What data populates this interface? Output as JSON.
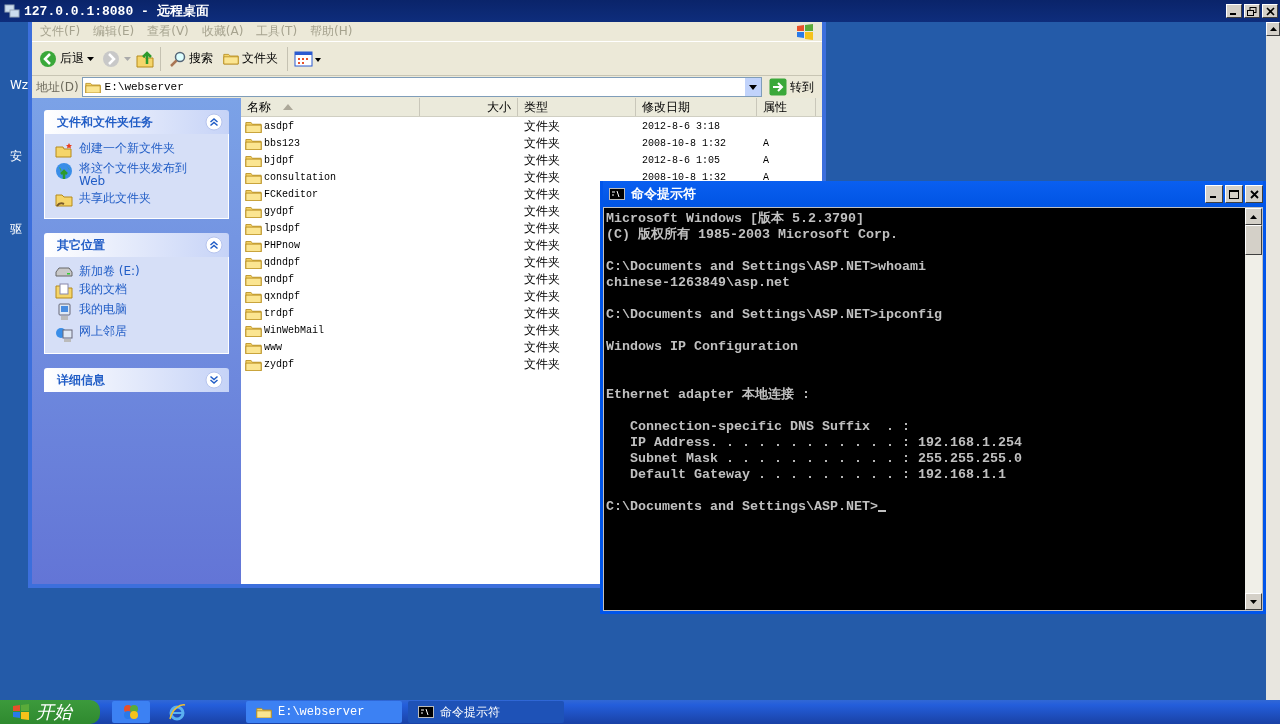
{
  "remote_window": {
    "title": "127.0.0.1:8080 - 远程桌面"
  },
  "desktop_labels": [
    "Wz",
    "安",
    "驱"
  ],
  "explorer": {
    "menu": [
      {
        "label": "文件(F)",
        "disabled": true
      },
      {
        "label": "编辑(E)",
        "disabled": true
      },
      {
        "label": "查看(V)",
        "disabled": true
      },
      {
        "label": "收藏(A)",
        "disabled": true
      },
      {
        "label": "工具(T)",
        "disabled": true
      },
      {
        "label": "帮助(H)",
        "disabled": true
      }
    ],
    "toolbar": {
      "back": "后退",
      "search": "搜索",
      "folders": "文件夹"
    },
    "address": {
      "label": "地址(D)",
      "value": "E:\\webserver",
      "go": "转到"
    },
    "panels": [
      {
        "title": "文件和文件夹任务",
        "expanded": true,
        "items": [
          {
            "label": "创建一个新文件夹",
            "kind": "new-folder"
          },
          {
            "label": "将这个文件夹发布到 Web",
            "kind": "publish"
          },
          {
            "label": "共享此文件夹",
            "kind": "share"
          }
        ]
      },
      {
        "title": "其它位置",
        "expanded": true,
        "items": [
          {
            "label": "新加卷 (E:)",
            "kind": "drive"
          },
          {
            "label": "我的文档",
            "kind": "documents"
          },
          {
            "label": "我的电脑",
            "kind": "computer"
          },
          {
            "label": "网上邻居",
            "kind": "network"
          }
        ]
      },
      {
        "title": "详细信息",
        "expanded": false
      }
    ],
    "columns": [
      {
        "label": "名称",
        "sorted": true
      },
      {
        "label": "大小",
        "sorted": false
      },
      {
        "label": "类型",
        "sorted": false
      },
      {
        "label": "修改日期",
        "sorted": false
      },
      {
        "label": "属性",
        "sorted": false
      }
    ],
    "rows": [
      {
        "name": "asdpf",
        "type": "文件夹",
        "modified": "2012-8-6 3:18"
      },
      {
        "name": "bbs123",
        "type": "文件夹",
        "modified": "2008-10-8 1:32",
        "attributes": "A"
      },
      {
        "name": "bjdpf",
        "type": "文件夹",
        "modified": "2012-8-6 1:05",
        "attributes": "A"
      },
      {
        "name": "consultation",
        "type": "文件夹",
        "modified": "2008-10-8 1:32",
        "attributes": "A"
      },
      {
        "name": "FCKeditor",
        "type": "文件夹"
      },
      {
        "name": "gydpf",
        "type": "文件夹"
      },
      {
        "name": "lpsdpf",
        "type": "文件夹"
      },
      {
        "name": "PHPnow",
        "type": "文件夹"
      },
      {
        "name": "qdndpf",
        "type": "文件夹"
      },
      {
        "name": "qndpf",
        "type": "文件夹"
      },
      {
        "name": "qxndpf",
        "type": "文件夹"
      },
      {
        "name": "trdpf",
        "type": "文件夹"
      },
      {
        "name": "WinWebMail",
        "type": "文件夹"
      },
      {
        "name": "www",
        "type": "文件夹"
      },
      {
        "name": "zydpf",
        "type": "文件夹"
      }
    ]
  },
  "console": {
    "title": "命令提示符",
    "lines": [
      {
        "kind": "text",
        "text": "Microsoft Windows [版本 5.2.3790]"
      },
      {
        "kind": "text",
        "text": "(C) 版权所有 1985-2003 Microsoft Corp."
      },
      {
        "kind": "blank"
      },
      {
        "kind": "text",
        "text": "C:\\Documents and Settings\\ASP.NET>whoami"
      },
      {
        "kind": "text",
        "text": "chinese-1263849\\asp.net"
      },
      {
        "kind": "blank"
      },
      {
        "kind": "text",
        "text": "C:\\Documents and Settings\\ASP.NET>ipconfig"
      },
      {
        "kind": "blank"
      },
      {
        "kind": "text",
        "text": "Windows IP Configuration"
      },
      {
        "kind": "blank"
      },
      {
        "kind": "blank"
      },
      {
        "kind": "text",
        "text": "Ethernet adapter 本地连接 :"
      },
      {
        "kind": "blank"
      },
      {
        "kind": "text",
        "text": "   Connection-specific DNS Suffix  . :"
      },
      {
        "kind": "text",
        "text": "   IP Address. . . . . . . . . . . . : 192.168.1.254"
      },
      {
        "kind": "text",
        "text": "   Subnet Mask . . . . . . . . . . . : 255.255.255.0"
      },
      {
        "kind": "text",
        "text": "   Default Gateway . . . . . . . . . : 192.168.1.1"
      },
      {
        "kind": "blank"
      },
      {
        "kind": "prompt",
        "text": "C:\\Documents and Settings\\ASP.NET>"
      }
    ]
  },
  "taskbar": {
    "start": "开始",
    "tasks": [
      {
        "label": "E:\\webserver",
        "kind": "folder",
        "selected": false
      },
      {
        "label": "命令提示符",
        "kind": "console",
        "selected": true
      }
    ]
  }
}
